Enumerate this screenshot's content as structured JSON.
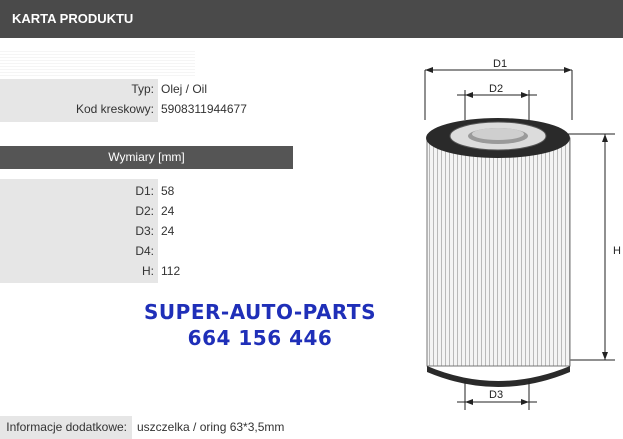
{
  "header": {
    "title": "KARTA PRODUKTU"
  },
  "product": {
    "type_label": "Typ:",
    "type_value": "Olej / Oil",
    "barcode_label": "Kod kreskowy:",
    "barcode_value": "5908311944677"
  },
  "dimensions": {
    "section_title": "Wymiary [mm]",
    "rows": [
      {
        "label": "D1:",
        "value": "58"
      },
      {
        "label": "D2:",
        "value": "24"
      },
      {
        "label": "D3:",
        "value": "24"
      },
      {
        "label": "D4:",
        "value": ""
      },
      {
        "label": "H:",
        "value": "112"
      }
    ]
  },
  "promo": {
    "line1": "SUPER-AUTO-PARTS",
    "line2": "664 156 446"
  },
  "additional": {
    "label": "Informacje dodatkowe:",
    "value": "uszczelka / oring 63*3,5mm"
  },
  "drawing": {
    "d1": "D1",
    "d2": "D2",
    "d3": "D3",
    "h": "H"
  }
}
